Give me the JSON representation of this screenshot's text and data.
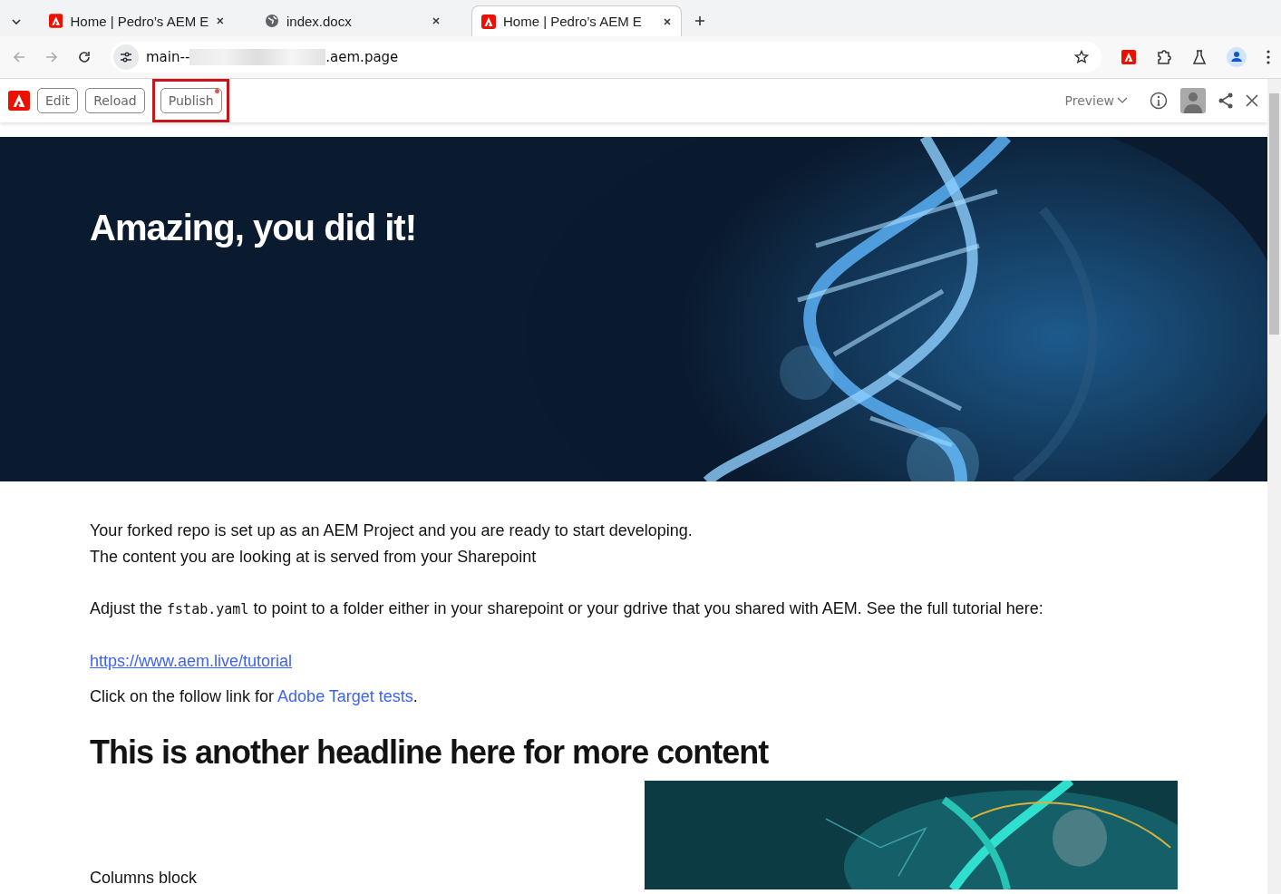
{
  "browser": {
    "tabs": [
      {
        "title": "Home | Pedro’s AEM E",
        "kind": "site",
        "selected": false
      },
      {
        "title": "index.docx",
        "kind": "document",
        "selected": false
      },
      {
        "title": "Home | Pedro’s AEM E",
        "kind": "site",
        "selected": true
      }
    ],
    "address": {
      "prefix": "main--",
      "suffix": ".aem.page"
    }
  },
  "sidekick": {
    "buttons": [
      {
        "label": "Edit",
        "highlighted": false,
        "badge": false
      },
      {
        "label": "Reload",
        "highlighted": false,
        "badge": false
      },
      {
        "label": "Publish",
        "highlighted": true,
        "badge": true
      }
    ],
    "environment": "Preview"
  },
  "page": {
    "hero_title": "Amazing, you did it!",
    "paragraphs": [
      {
        "kind": "lines",
        "lines": [
          "Your forked repo is set up as an AEM Project and you are ready to start developing.",
          "The content you are looking at is served from your Sharepoint"
        ]
      },
      {
        "kind": "code",
        "before": "Adjust the ",
        "code": "fstab.yaml",
        "after": " to point to a folder either in your sharepoint or your gdrive that you shared with AEM. See the full tutorial here:"
      },
      {
        "kind": "url",
        "link": "https://www.aem.live/tutorial"
      },
      {
        "kind": "inline_link",
        "before": "Click on the follow link for ",
        "link": "Adobe Target tests",
        "after": "."
      }
    ],
    "headline": "This is another headline here for more content",
    "columns_text": "Columns block"
  }
}
